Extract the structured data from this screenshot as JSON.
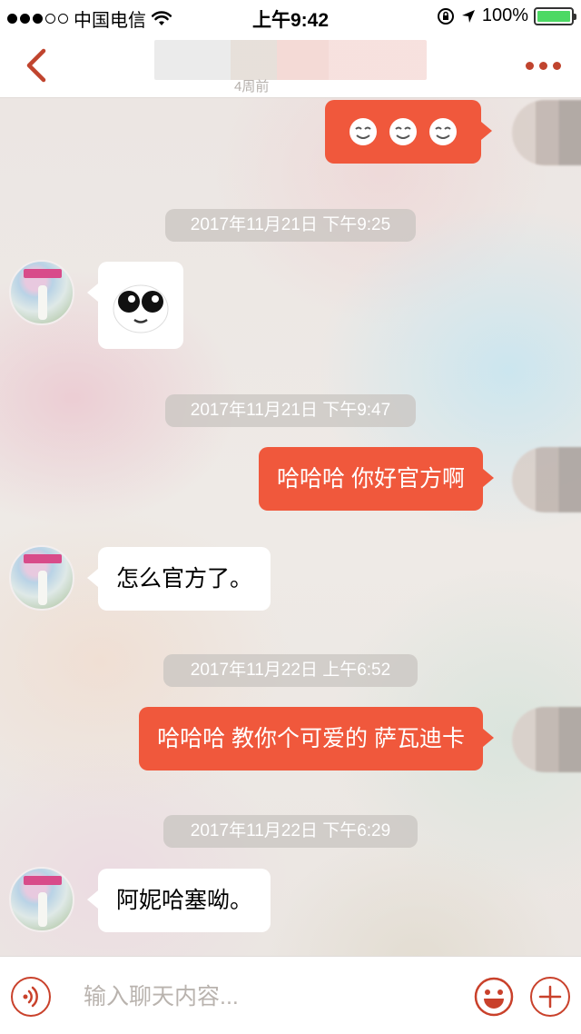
{
  "status_bar": {
    "carrier": "中国电信",
    "time": "上午9:42",
    "battery": "100%",
    "battery_level": 1.0
  },
  "nav": {
    "subtitle": "4周前"
  },
  "messages": [
    {
      "type": "sticker",
      "direction": "out",
      "icon": "smile-faces-emoji"
    },
    {
      "type": "time",
      "text": "2017年11月21日 下午9:25"
    },
    {
      "type": "sticker",
      "direction": "in",
      "icon": "panda-face-emoji"
    },
    {
      "type": "time",
      "text": "2017年11月21日 下午9:47"
    },
    {
      "type": "text",
      "direction": "out",
      "text": "哈哈哈 你好官方啊"
    },
    {
      "type": "text",
      "direction": "in",
      "text": "怎么官方了。"
    },
    {
      "type": "time",
      "text": "2017年11月22日 上午6:52"
    },
    {
      "type": "text",
      "direction": "out",
      "text": "哈哈哈 教你个可爱的 萨瓦迪卡"
    },
    {
      "type": "time",
      "text": "2017年11月22日 下午6:29"
    },
    {
      "type": "text",
      "direction": "in",
      "text": "阿妮哈塞呦。"
    }
  ],
  "input": {
    "placeholder": "输入聊天内容..."
  },
  "colors": {
    "accent": "#c0442e",
    "bubble_out": "#f0583c",
    "bubble_in": "#ffffff"
  },
  "icons": {
    "back": "chevron-left-icon",
    "more": "more-dots-icon",
    "voice": "voice-icon",
    "emoji": "emoji-icon",
    "plus": "plus-icon"
  }
}
